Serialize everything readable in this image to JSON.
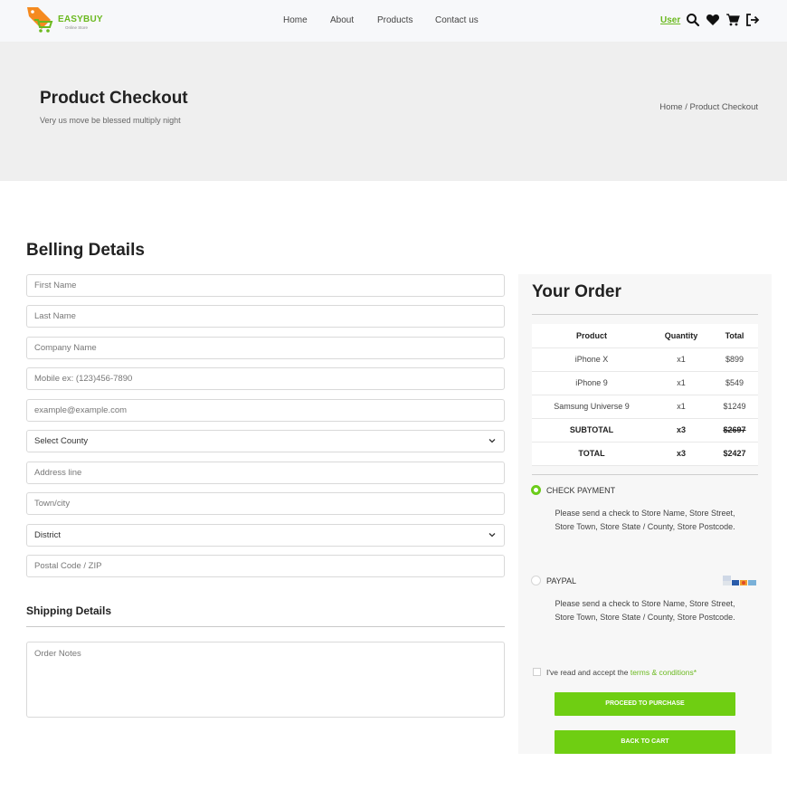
{
  "brand": {
    "name": "EASYBUY",
    "tagline": "Online Store",
    "accent": "#6bb91f"
  },
  "nav": {
    "items": [
      "Home",
      "About",
      "Products",
      "Contact us"
    ]
  },
  "header": {
    "user_label": "User",
    "icons": [
      "search-icon",
      "heart-icon",
      "cart-icon",
      "logout-icon"
    ]
  },
  "banner": {
    "title": "Product Checkout",
    "subtitle": "Very us move be blessed multiply night",
    "breadcrumb_home": "Home",
    "breadcrumb_sep": " / ",
    "breadcrumb_current": "Product Checkout"
  },
  "billing": {
    "title": "Belling Details",
    "first_name": "First Name",
    "last_name": "Last Name",
    "company": "Company Name",
    "mobile": "Mobile ex: (123)456-7890",
    "email": "example@example.com",
    "county": "Select County",
    "address": "Address line",
    "town": "Town/city",
    "district": "District",
    "postal": "Postal Code / ZIP"
  },
  "shipping": {
    "title": "Shipping Details",
    "notes_placeholder": "Order Notes"
  },
  "order": {
    "title": "Your Order",
    "headers": [
      "Product",
      "Quantity",
      "Total"
    ],
    "rows": [
      {
        "product": "iPhone X",
        "qty": "x1",
        "total": "$899"
      },
      {
        "product": "iPhone 9",
        "qty": "x1",
        "total": "$549"
      },
      {
        "product": "Samsung Universe 9",
        "qty": "x1",
        "total": "$1249"
      }
    ],
    "subtotal": {
      "label": "SUBTOTAL",
      "qty": "x3",
      "total": "$2697"
    },
    "total": {
      "label": "TOTAL",
      "qty": "x3",
      "total": "$2427"
    }
  },
  "payment": {
    "check_label": "CHECK PAYMENT",
    "check_desc": "Please send a check to Store Name, Store Street, Store Town, Store State / County, Store Postcode.",
    "paypal_label": "PAYPAL",
    "paypal_desc": "Please send a check to Store Name, Store Street, Store Town, Store State / County, Store Postcode.",
    "selected": "check"
  },
  "terms": {
    "prefix": "I've read and accept the ",
    "link": "terms & conditions*"
  },
  "buttons": {
    "purchase": "PROCEED TO PURCHASE",
    "back": "BACK TO CART",
    "color": "#6fce12"
  }
}
